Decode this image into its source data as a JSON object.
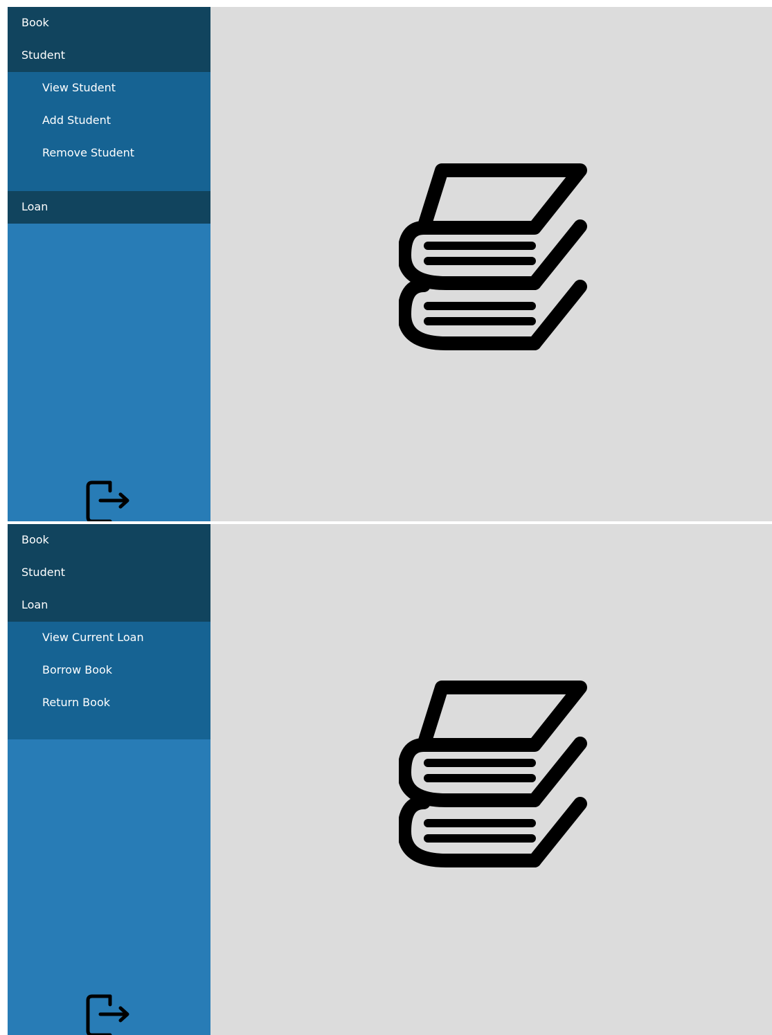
{
  "screens": [
    {
      "menu": {
        "book": "Book",
        "student": "Student",
        "student_submenu": [
          "View Student",
          "Add Student",
          "Remove Student"
        ],
        "loan": "Loan"
      },
      "icons": {
        "logout": "logout-icon",
        "main": "books-icon"
      }
    },
    {
      "menu": {
        "book": "Book",
        "student": "Student",
        "loan": "Loan",
        "loan_submenu": [
          "View Current Loan",
          "Borrow Book",
          "Return Book"
        ]
      },
      "icons": {
        "logout": "logout-icon",
        "main": "books-icon"
      }
    }
  ],
  "colors": {
    "sidebar": "#287cb6",
    "menu_header": "#11445e",
    "submenu": "#166393",
    "content_bg": "#dcdcdc"
  }
}
